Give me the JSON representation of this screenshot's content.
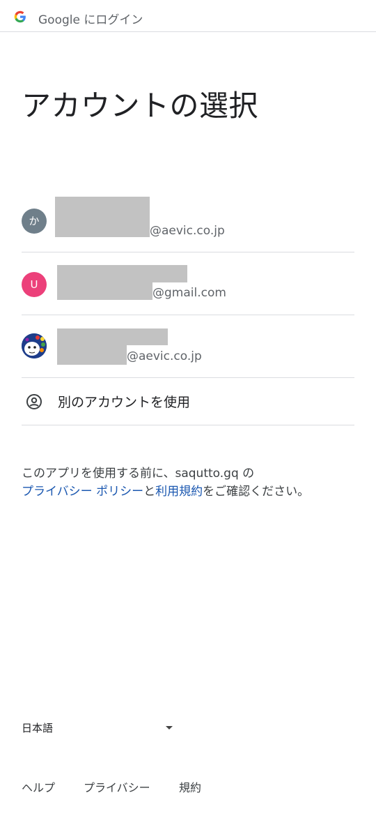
{
  "header": {
    "title": "Google にログイン"
  },
  "page_title": "アカウントの選択",
  "accounts": [
    {
      "avatar_text": "か",
      "avatar_color": "#6f7f8a",
      "email_suffix": "@aevic.co.jp"
    },
    {
      "avatar_text": "U",
      "avatar_color": "#ec407a",
      "email_suffix": "@gmail.com"
    },
    {
      "avatar_text": "",
      "avatar_icon": "cartoon-avatar-image",
      "email_suffix": "@aevic.co.jp"
    }
  ],
  "use_another": {
    "icon": "account-circle-icon",
    "label": "別のアカウントを使用"
  },
  "notice": {
    "prefix": "このアプリを使用する前に、saqutto.gq の",
    "privacy_link": "プライバシー ポリシー",
    "and": "と",
    "terms_link": "利用規約",
    "suffix": "をご確認ください。"
  },
  "language": {
    "selected": "日本語"
  },
  "footer": {
    "help": "ヘルプ",
    "privacy": "プライバシー",
    "terms": "規約"
  },
  "colors": {
    "link": "#1a57b0",
    "divider": "#dadce0",
    "redaction": "#c2c2c2"
  }
}
